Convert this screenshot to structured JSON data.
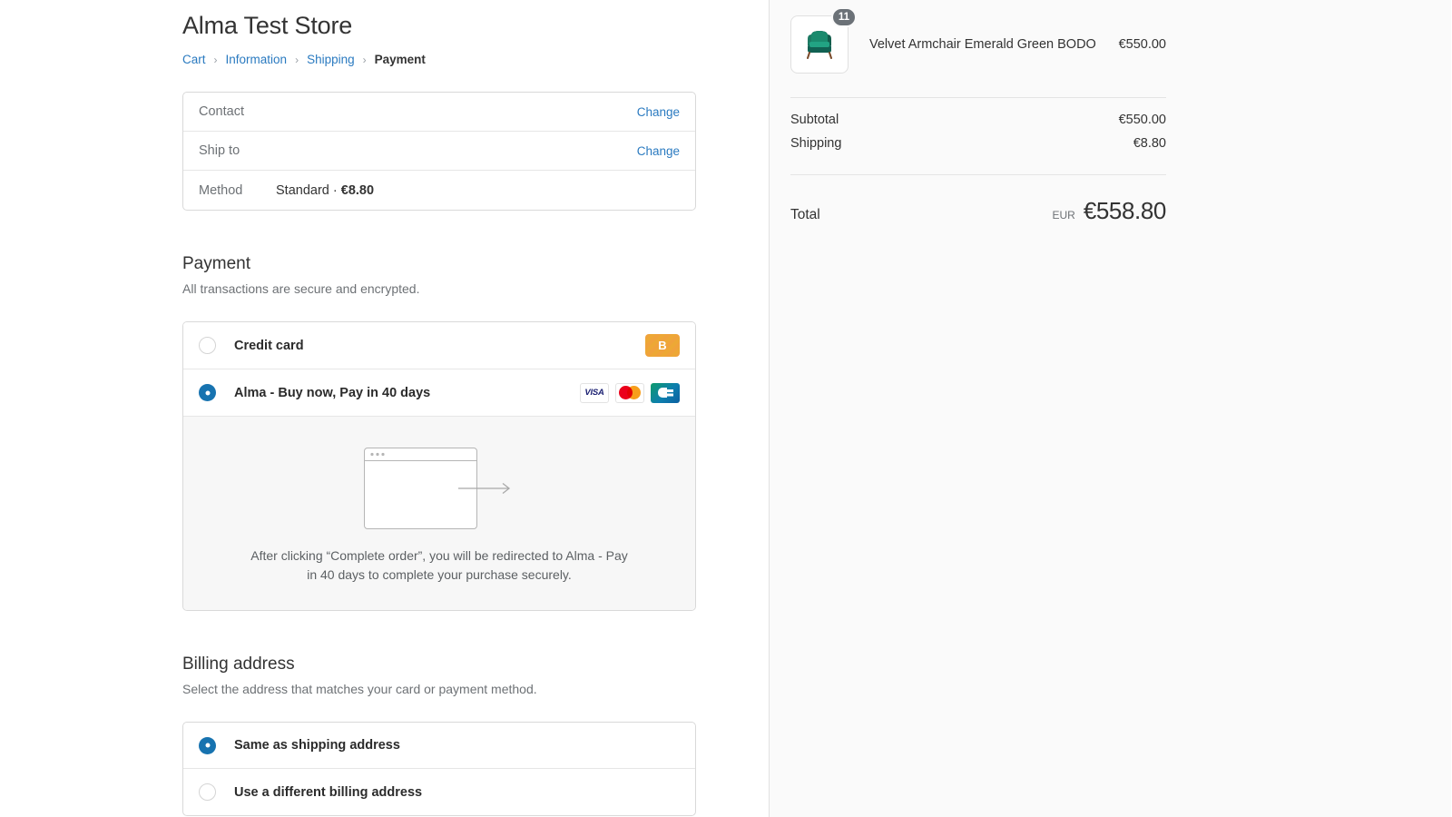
{
  "store": {
    "title": "Alma Test Store"
  },
  "breadcrumb": {
    "items": [
      {
        "label": "Cart",
        "current": false
      },
      {
        "label": "Information",
        "current": false
      },
      {
        "label": "Shipping",
        "current": false
      },
      {
        "label": "Payment",
        "current": true
      }
    ],
    "separator": "›"
  },
  "review": {
    "rows": [
      {
        "label": "Contact",
        "value": "",
        "action": "Change"
      },
      {
        "label": "Ship to",
        "value": "",
        "action": "Change"
      },
      {
        "label": "Method",
        "value_prefix": "Standard · ",
        "value_bold": "€8.80",
        "action": ""
      }
    ]
  },
  "payment": {
    "title": "Payment",
    "subtitle": "All transactions are secure and encrypted.",
    "methods": [
      {
        "label": "Credit card",
        "selected": false,
        "badges": [
          "bogus-b-badge"
        ]
      },
      {
        "label": "Alma - Buy now, Pay in 40 days",
        "selected": true,
        "badges": [
          "visa-icon",
          "mastercard-icon",
          "cb-icon"
        ]
      }
    ],
    "bogus_badge_label": "B",
    "visa_label": "VISA",
    "redirect_notice": "After clicking “Complete order”, you will be redirected to Alma - Pay in 40 days to complete your purchase securely."
  },
  "billing": {
    "title": "Billing address",
    "subtitle": "Select the address that matches your card or payment method.",
    "options": [
      {
        "label": "Same as shipping address",
        "selected": true
      },
      {
        "label": "Use a different billing address",
        "selected": false
      }
    ]
  },
  "summary": {
    "item": {
      "name": "Velvet Armchair Emerald Green BODO",
      "price": "€550.00",
      "quantity": "11"
    },
    "lines": [
      {
        "label": "Subtotal",
        "value": "€550.00"
      },
      {
        "label": "Shipping",
        "value": "€8.80"
      }
    ],
    "total": {
      "label": "Total",
      "currency": "EUR",
      "amount": "€558.80"
    }
  },
  "colors": {
    "link": "#2a7ac0",
    "radio_selected": "#1773b0",
    "panel_bg": "#fafafa",
    "badge_gray": "#6b7177",
    "bogus_orange": "#f0a23c"
  }
}
